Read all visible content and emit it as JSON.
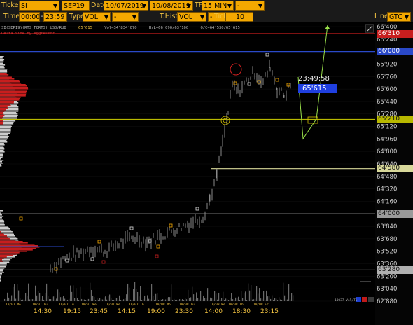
{
  "toolbar": {
    "row1": {
      "ticker_label": "Ticker",
      "ticker_value": "SI",
      "contract_value": "SEP19",
      "date_label": "Date",
      "date_from": "10/07/2019",
      "date_to": "10/08/2019",
      "tf_label": "TF",
      "tf_value": "15 MIN",
      "tf_extra": "-"
    },
    "row2": {
      "time_label": "Time",
      "time_from": "00:00",
      "time_to": "23:59",
      "type_label": "Type",
      "type_value": "VOL",
      "type_extra": "-",
      "thist_label": "T.Hist",
      "thist_value": "VOL",
      "thist_extra": "-",
      "tick_label": "Tick",
      "tick_value": "10",
      "line_label": "Line",
      "line_value": "GTC"
    }
  },
  "chart": {
    "info_symbol": "SI(SEP19)(RTS FORTS) USD/RUB",
    "info_last": "65'615",
    "info_vol": "Vol=34'834'070",
    "info_hl": "H/L=66'090/63'100",
    "info_oc": "O/C=64'530/65'615",
    "tagline": "Delta Side by Aggressor",
    "current_time": "23:49:58",
    "current_price": "65'615",
    "price_axis": [
      "66'400",
      "66'240",
      "66'080",
      "65'920",
      "65'760",
      "65'600",
      "65'440",
      "65'280",
      "65'120",
      "64'960",
      "64'800",
      "64'640",
      "64'480",
      "64'320",
      "64'160",
      "64'000",
      "63'840",
      "63'680",
      "63'520",
      "63'360",
      "63'200",
      "63'040",
      "62'880"
    ],
    "level_labels": [
      {
        "price": "66'310",
        "color": "#c81e1e"
      },
      {
        "price": "66'080",
        "color": "#2a49c9"
      },
      {
        "price": "65'210",
        "color": "#b8b800"
      },
      {
        "price": "64'580",
        "color": "#d8d89a"
      },
      {
        "price": "64'000",
        "color": "#9a9a9a"
      },
      {
        "price": "63'280",
        "color": "#b0b0b0"
      }
    ],
    "time_labels": [
      "14:30",
      "19:15",
      "23:45",
      "14:15",
      "19:00",
      "23:30",
      "14:00",
      "18:30",
      "23:15"
    ],
    "date_labels": [
      "10/07 Mo",
      "10/07 Tu",
      "10/07 Tu",
      "10/07 We",
      "10/07 We",
      "10/07 Th",
      "10/08 Mo",
      "10/08 Tu",
      "10/08 We",
      "10/08 Th",
      "10/08 Fr"
    ],
    "vol_label": "10037 Vol/Ti",
    "colors": {
      "accent": "#f4a800",
      "bid": "#c81e1e",
      "ask": "#e0e0e0",
      "bg": "#000000"
    }
  }
}
